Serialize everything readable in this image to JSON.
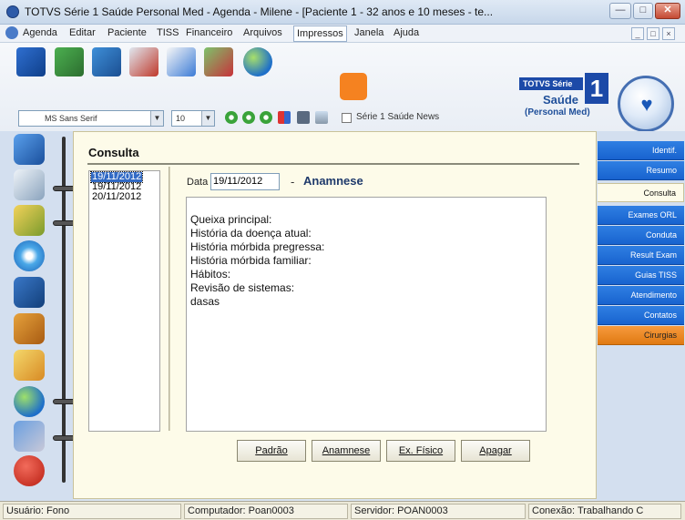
{
  "window": {
    "title": "TOTVS Série 1 Saúde Personal Med - Agenda - Milene - [Paciente 1 - 32 anos e 10 meses - te...",
    "buttons": {
      "minimize": "—",
      "maximize": "□",
      "close": "✕"
    }
  },
  "menu": {
    "items": [
      "Agenda",
      "Editar",
      "Paciente",
      "TISS",
      "Financeiro",
      "Arquivos",
      "Impressos",
      "Janela",
      "Ajuda"
    ],
    "mdi_controls": [
      "_",
      "□",
      "×"
    ]
  },
  "toolbar": {
    "font_name": "MS Sans Serif",
    "font_size": "10",
    "news_checkbox_label": "Série 1 Saúde News",
    "news_checked": false,
    "icons": [
      "agenda-icon",
      "patients-icon",
      "book-icon",
      "lab-flask-icon",
      "notes-icon",
      "pharmacy-icon",
      "globe-icon",
      "rss-icon"
    ]
  },
  "brand": {
    "tag": "TOTVS Série",
    "number": "1",
    "line1": "Saúde",
    "line2": "(Personal Med)"
  },
  "sidebar_icons": [
    "save-icon",
    "notebook-icon",
    "calendar-icon",
    "disc-icon",
    "phone-icon",
    "book-icon",
    "address-book-icon",
    "globe-icon",
    "pencil-icon",
    "exit-icon"
  ],
  "main": {
    "section_title": "Consulta",
    "dates": [
      "19/11/2012",
      "19/11/2012",
      "20/11/2012"
    ],
    "selected_date_index": 0,
    "date_label": "Data",
    "date_value": "19/11/2012",
    "dash": "-",
    "form_title": "Anamnese",
    "notes": [
      "Queixa principal:",
      "História da doença atual:",
      "História mórbida pregressa:",
      "História mórbida familiar:",
      "Hábitos:",
      "Revisão de sistemas:",
      "dasas"
    ],
    "buttons": {
      "default": "Padrão",
      "anamnese": "Anamnese",
      "exam": "Ex. Físico",
      "delete": "Apagar"
    }
  },
  "tabs": [
    {
      "label": "Identif."
    },
    {
      "label": "Resumo"
    },
    {
      "label": "Consulta"
    },
    {
      "label": "Exames ORL"
    },
    {
      "label": "Conduta"
    },
    {
      "label": "Result Exam"
    },
    {
      "label": "Guias TISS"
    },
    {
      "label": "Atendimento"
    },
    {
      "label": "Contatos"
    },
    {
      "label": "Cirurgias"
    }
  ],
  "active_tab": "Consulta",
  "status": {
    "user": "Usuário: Fono",
    "computer": "Computador: Poan0003",
    "server": "Servidor: POAN0003",
    "connection": "Conexão: Trabalhando C"
  },
  "colors": {
    "tab_blue": "#1f6fdc",
    "tab_orange": "#f08a22",
    "panel_bg": "#fdfbe9",
    "selection": "#316ac5",
    "brand_blue": "#1c4aa8"
  }
}
